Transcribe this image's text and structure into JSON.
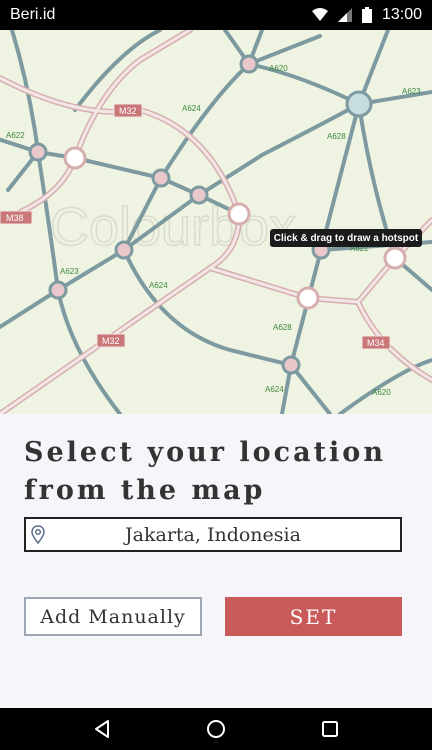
{
  "status_bar": {
    "app_name": "Beri.id",
    "time": "13:00",
    "icons": [
      "wifi-icon",
      "signal-icon",
      "battery-icon"
    ]
  },
  "map": {
    "tooltip": "Click & drag to draw a hotspot",
    "watermark": "Colourbox",
    "road_labels": [
      "A620",
      "A623",
      "M32",
      "A624",
      "A628",
      "A622",
      "M38",
      "A623",
      "A624",
      "A622",
      "A628",
      "M32",
      "M34",
      "A624",
      "A620"
    ]
  },
  "panel": {
    "heading": "Select your location from the map",
    "location_value": "Jakarta, Indonesia",
    "add_manually_label": "Add Manually",
    "set_label": "SET"
  },
  "nav_bar": {
    "icons": [
      "back-icon",
      "home-icon",
      "recents-icon"
    ]
  },
  "colors": {
    "map_background": "#eff3e2",
    "road_blue": "#7d9aa0",
    "road_pink": "#e8c8c8",
    "set_button": "#c95a5a",
    "panel_background": "#f6f5f9"
  }
}
